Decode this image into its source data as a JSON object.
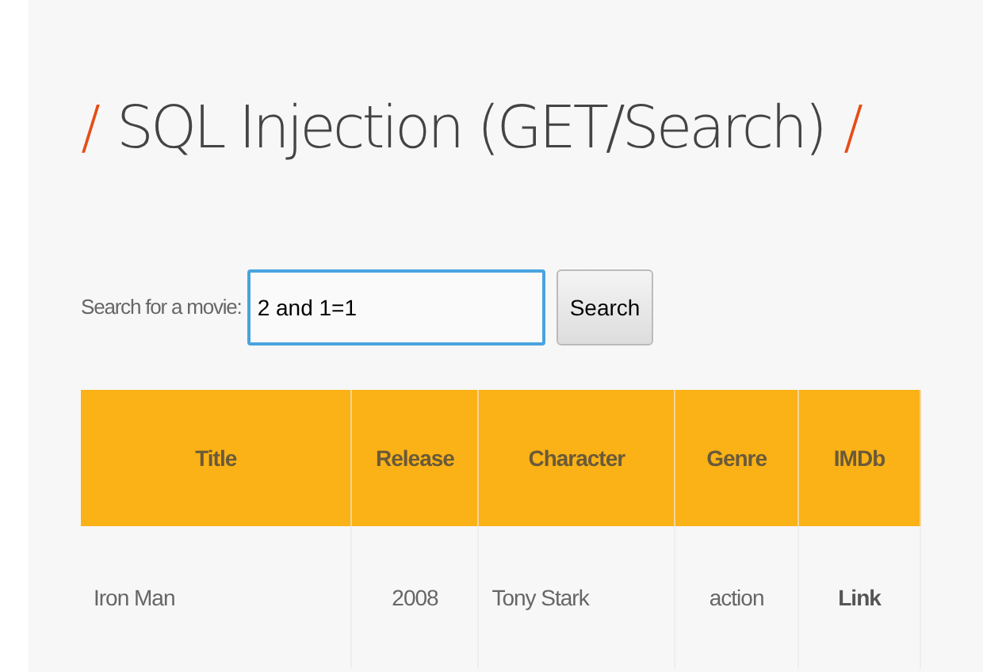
{
  "heading": {
    "text": "SQL Injection (GET/Search)",
    "slash": "/"
  },
  "search": {
    "label": "Search for a movie:",
    "value": "2 and 1=1",
    "button": "Search"
  },
  "table": {
    "columns": [
      {
        "label": "Title"
      },
      {
        "label": "Release"
      },
      {
        "label": "Character"
      },
      {
        "label": "Genre"
      },
      {
        "label": "IMDb"
      }
    ],
    "rows": [
      {
        "cells": [
          "Iron Man",
          "2008",
          "Tony Stark",
          "action",
          "Link"
        ]
      }
    ]
  }
}
